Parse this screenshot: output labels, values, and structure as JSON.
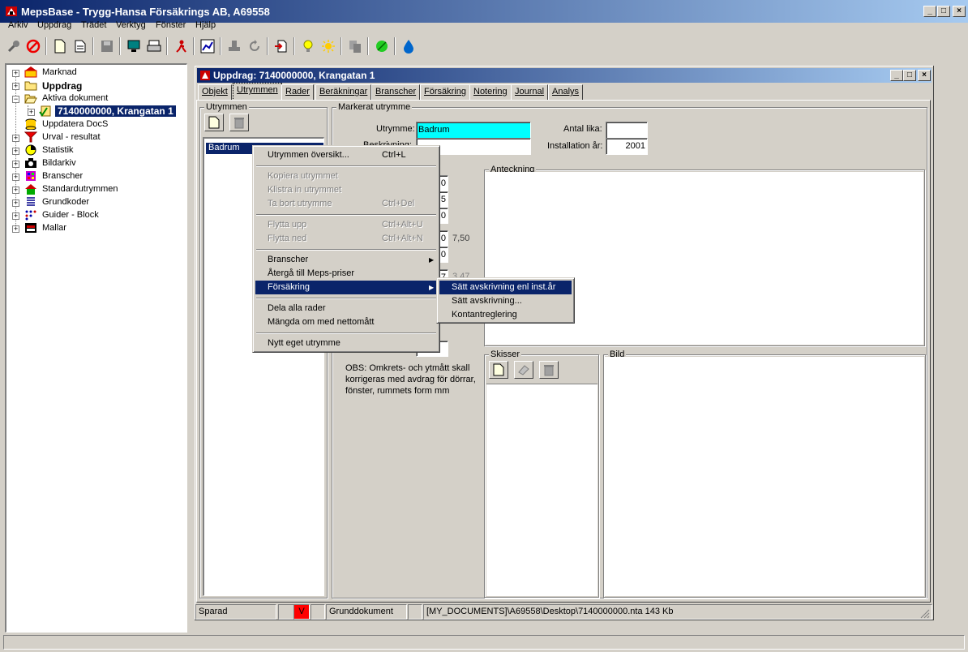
{
  "app": {
    "title": "MepsBase - Trygg-Hansa Försäkrings AB, A69558",
    "window_buttons": [
      "_",
      "□",
      "×"
    ]
  },
  "menubar": [
    "Arkiv",
    "Uppdrag",
    "Trädet",
    "Verktyg",
    "Fönster",
    "Hjälp"
  ],
  "tree": {
    "items": [
      {
        "label": "Marknad",
        "icon": "market-icon"
      },
      {
        "label": "Uppdrag",
        "icon": "folder-icon"
      },
      {
        "label": "Aktiva dokument",
        "icon": "open-folder-icon"
      },
      {
        "label": "7140000000, Krangatan 1",
        "icon": "document-check-icon"
      },
      {
        "label": "Uppdatera DocS",
        "icon": "database-icon"
      },
      {
        "label": "Urval - resultat",
        "icon": "funnel-icon"
      },
      {
        "label": "Statistik",
        "icon": "pie-chart-icon"
      },
      {
        "label": "Bildarkiv",
        "icon": "camera-icon"
      },
      {
        "label": "Branscher",
        "icon": "grid-icon"
      },
      {
        "label": "Standardutrymmen",
        "icon": "house-icon"
      },
      {
        "label": "Grundkoder",
        "icon": "list-icon"
      },
      {
        "label": "Guider - Block",
        "icon": "dots-icon"
      },
      {
        "label": "Mallar",
        "icon": "template-icon"
      }
    ]
  },
  "child": {
    "title": "Uppdrag: 7140000000, Krangatan 1",
    "tabs": [
      "Objekt",
      "Utrymmen",
      "Rader",
      "Beräkningar",
      "Branscher",
      "Försäkring",
      "Notering",
      "Journal",
      "Analys"
    ],
    "active_tab": "Utrymmen"
  },
  "utrymmen": {
    "group_label": "Utrymmen",
    "list": [
      "Badrum"
    ]
  },
  "markerat": {
    "group_label": "Markerat utrymme",
    "utrymme_label": "Utrymme:",
    "utrymme_value": "Badrum",
    "beskrivning_label": "Beskrivning:",
    "antal_label": "Antal lika:",
    "antal_value": "",
    "install_label": "Installation år:",
    "install_value": "2001",
    "partial_values": [
      "0",
      "5",
      "0",
      "0",
      "7,50",
      "0",
      "7",
      "3,47"
    ],
    "anteckning_label": "Anteckning",
    "obs_text": "OBS: Omkrets- och ytmått skall korrigeras med avdrag för dörrar, fönster, rummets form mm",
    "skisser_label": "Skisser",
    "bild_label": "Bild"
  },
  "context_menu": {
    "items": [
      {
        "label": "Utrymmen översikt...",
        "shortcut": "Ctrl+L",
        "disabled": false
      },
      {
        "label": "Kopiera utrymmet",
        "shortcut": "",
        "disabled": true
      },
      {
        "label": "Klistra in utrymmet",
        "shortcut": "",
        "disabled": true
      },
      {
        "label": "Ta bort utrymme",
        "shortcut": "Ctrl+Del",
        "disabled": true
      },
      {
        "label": "Flytta upp",
        "shortcut": "Ctrl+Alt+U",
        "disabled": true
      },
      {
        "label": "Flytta ned",
        "shortcut": "Ctrl+Alt+N",
        "disabled": true
      },
      {
        "label": "Branscher",
        "shortcut": "",
        "disabled": false
      },
      {
        "label": "Återgå till Meps-priser",
        "shortcut": "",
        "disabled": false
      },
      {
        "label": "Försäkring",
        "shortcut": "",
        "disabled": false
      },
      {
        "label": "Dela alla rader",
        "shortcut": "",
        "disabled": false
      },
      {
        "label": "Mängda om med nettomått",
        "shortcut": "",
        "disabled": false
      },
      {
        "label": "Nytt eget utrymme",
        "shortcut": "",
        "disabled": false
      }
    ],
    "submenu": [
      "Sätt avskrivning enl inst.år",
      "Sätt avskrivning...",
      "Kontantreglering"
    ]
  },
  "statusbar": {
    "state": "Sparad",
    "flag": "V",
    "doc_type": "Grunddokument",
    "path": "[MY_DOCUMENTS]\\A69558\\Desktop\\7140000000.nta  143 Kb"
  },
  "colors": {
    "title_start": "#0a246a",
    "title_end": "#a6caf0",
    "highlight": "#0a246a",
    "cyan_field": "#00ffff",
    "flag_red": "#ff0000"
  }
}
